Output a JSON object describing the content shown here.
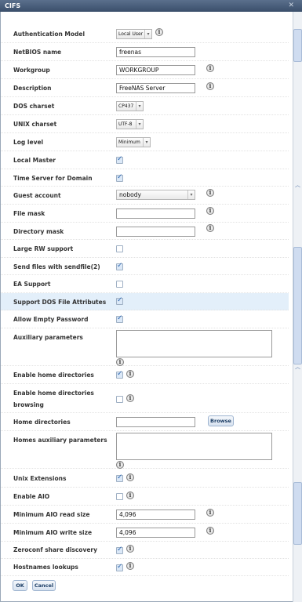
{
  "window": {
    "title": "CIFS",
    "close_glyph": "✕"
  },
  "fields": {
    "authentication_model": {
      "label": "Authentication Model",
      "value": "Local User"
    },
    "netbios_name": {
      "label": "NetBIOS name",
      "value": "freenas"
    },
    "workgroup": {
      "label": "Workgroup",
      "value": "WORKGROUP"
    },
    "description": {
      "label": "Description",
      "value": "FreeNAS Server"
    },
    "dos_charset": {
      "label": "DOS charset",
      "value": "CP437"
    },
    "unix_charset": {
      "label": "UNIX charset",
      "value": "UTF-8"
    },
    "log_level": {
      "label": "Log level",
      "value": "Minimum"
    },
    "local_master": {
      "label": "Local Master",
      "checked": true
    },
    "time_server": {
      "label": "Time Server for Domain",
      "checked": true
    },
    "guest_account": {
      "label": "Guest account",
      "value": "nobody"
    },
    "file_mask": {
      "label": "File mask",
      "value": ""
    },
    "directory_mask": {
      "label": "Directory mask",
      "value": ""
    },
    "large_rw": {
      "label": "Large RW support",
      "checked": false
    },
    "sendfile": {
      "label": "Send files with sendfile(2)",
      "checked": true
    },
    "ea_support": {
      "label": "EA Support",
      "checked": false
    },
    "dos_attributes": {
      "label": "Support DOS File Attributes",
      "checked": true
    },
    "allow_empty_password": {
      "label": "Allow Empty Password",
      "checked": true
    },
    "auxiliary_parameters": {
      "label": "Auxiliary parameters",
      "value": ""
    },
    "enable_home_dirs": {
      "label": "Enable home directories",
      "checked": true
    },
    "home_dirs_browsing": {
      "label_line1": "Enable home directories",
      "label_line2": "browsing",
      "checked": false
    },
    "home_directories": {
      "label": "Home directories",
      "value": "",
      "browse_label": "Browse"
    },
    "homes_aux_params": {
      "label": "Homes auxiliary parameters",
      "value": ""
    },
    "unix_extensions": {
      "label": "Unix Extensions",
      "checked": true
    },
    "enable_aio": {
      "label": "Enable AIO",
      "checked": false
    },
    "aio_read_size": {
      "label": "Minimum AIO read size",
      "value": "4,096"
    },
    "aio_write_size": {
      "label": "Minimum AIO write size",
      "value": "4,096"
    },
    "zeroconf": {
      "label": "Zeroconf share discovery",
      "checked": true
    },
    "hostnames_lookups": {
      "label": "Hostnames lookups",
      "checked": true
    }
  },
  "buttons": {
    "ok_label": "OK",
    "cancel_label": "Cancel"
  },
  "icons": {
    "info": "info-icon",
    "scroll_up": "chevron-up-icon"
  },
  "colors": {
    "titlebar": "#3b4f6b",
    "highlight_row": "#e3effa",
    "accent": "#3069b0"
  }
}
